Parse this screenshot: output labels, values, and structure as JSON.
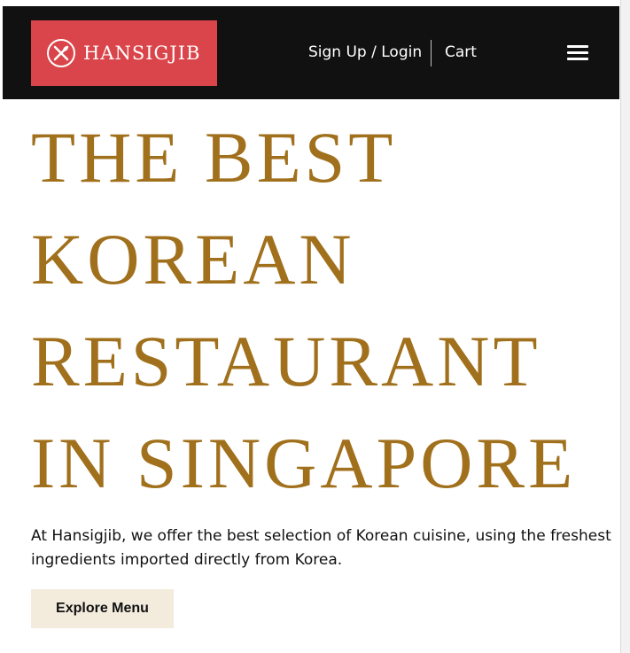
{
  "header": {
    "brand": {
      "name": "HANSIGJIB",
      "icon": "fork-spoon-icon",
      "badge_color": "#d9454a"
    },
    "nav": {
      "login_label": "Sign Up / Login",
      "cart_label": "Cart",
      "menu_icon": "hamburger-menu-icon"
    },
    "background_color": "#111111"
  },
  "hero": {
    "title_lines": [
      "THE BEST",
      "KOREAN",
      "RESTAURANT",
      "IN SINGAPORE"
    ],
    "title_color": "#a1701c",
    "description": "At Hansigjib, we offer the best selection of Korean cuisine, using the freshest ingredients imported directly from Korea.",
    "cta_label": "Explore Menu",
    "cta_color": "#f3ecdd"
  }
}
